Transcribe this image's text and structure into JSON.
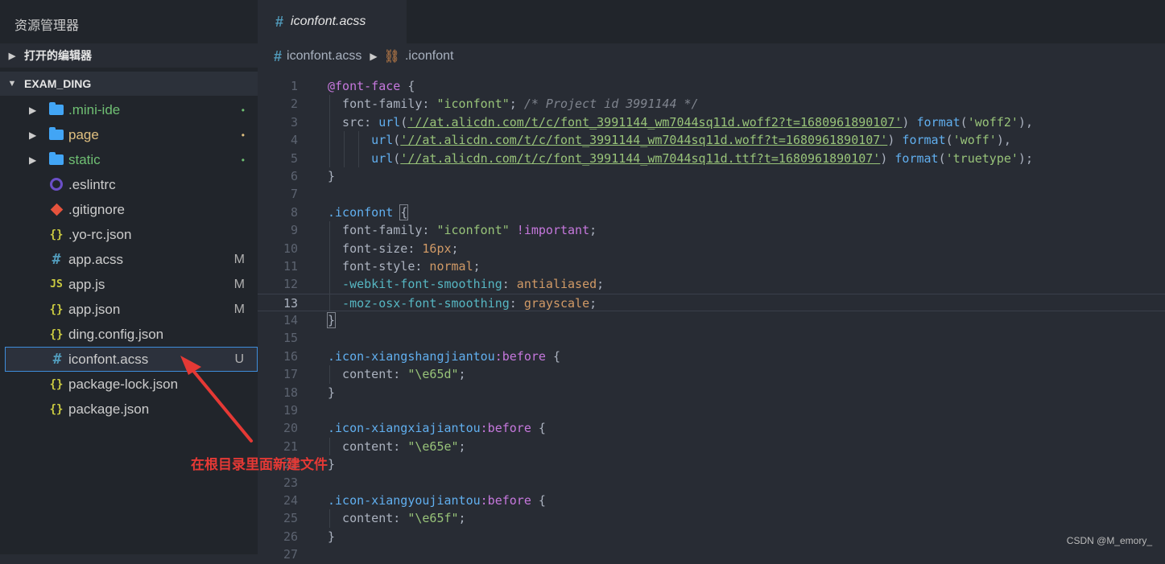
{
  "sidebar": {
    "title": "资源管理器",
    "open_editors": "打开的编辑器",
    "project": "EXAM_DING",
    "files": [
      {
        "name": ".mini-ide",
        "type": "folder",
        "badge": "•",
        "color": "#6fbf73"
      },
      {
        "name": "page",
        "type": "folder",
        "badge": "•",
        "color": "#e0c080"
      },
      {
        "name": "static",
        "type": "folder",
        "badge": "•",
        "color": "#6fbf73"
      },
      {
        "name": ".eslintrc",
        "type": "eslint",
        "badge": "",
        "color": "#cccccc"
      },
      {
        "name": ".gitignore",
        "type": "git",
        "badge": "",
        "color": "#cccccc"
      },
      {
        "name": ".yo-rc.json",
        "type": "json",
        "badge": "",
        "color": "#cccccc"
      },
      {
        "name": "app.acss",
        "type": "css",
        "badge": "M",
        "color": "#cccccc"
      },
      {
        "name": "app.js",
        "type": "js",
        "badge": "M",
        "color": "#cccccc"
      },
      {
        "name": "app.json",
        "type": "json",
        "badge": "M",
        "color": "#cccccc"
      },
      {
        "name": "ding.config.json",
        "type": "json",
        "badge": "",
        "color": "#cccccc"
      },
      {
        "name": "iconfont.acss",
        "type": "css",
        "badge": "U",
        "color": "#cccccc",
        "selected": true
      },
      {
        "name": "package-lock.json",
        "type": "json",
        "badge": "",
        "color": "#cccccc"
      },
      {
        "name": "package.json",
        "type": "json",
        "badge": "",
        "color": "#cccccc"
      }
    ]
  },
  "tab": {
    "label": "iconfont.acss"
  },
  "breadcrumb": {
    "file": "iconfont.acss",
    "symbol": ".iconfont"
  },
  "editor": {
    "current_line": 13,
    "lines": [
      {
        "n": "1",
        "tokens": [
          [
            "at",
            "@font-face"
          ],
          [
            "brace",
            " {"
          ]
        ]
      },
      {
        "n": "2",
        "indent": 1,
        "tokens": [
          [
            "prop",
            "font-family"
          ],
          [
            "brace",
            ": "
          ],
          [
            "str",
            "\"iconfont\""
          ],
          [
            "brace",
            "; "
          ],
          [
            "com",
            "/* Project id 3991144 */"
          ]
        ]
      },
      {
        "n": "3",
        "indent": 1,
        "tokens": [
          [
            "prop",
            "src"
          ],
          [
            "brace",
            ": "
          ],
          [
            "fn",
            "url"
          ],
          [
            "brace",
            "("
          ],
          [
            "url",
            "'//at.alicdn.com/t/c/font_3991144_wm7044sq11d.woff2?t=1680961890107'"
          ],
          [
            "brace",
            ") "
          ],
          [
            "fn",
            "format"
          ],
          [
            "brace",
            "("
          ],
          [
            "str",
            "'woff2'"
          ],
          [
            "brace",
            "),"
          ]
        ]
      },
      {
        "n": "4",
        "indent": 3,
        "tokens": [
          [
            "fn",
            "url"
          ],
          [
            "brace",
            "("
          ],
          [
            "url",
            "'//at.alicdn.com/t/c/font_3991144_wm7044sq11d.woff?t=1680961890107'"
          ],
          [
            "brace",
            ") "
          ],
          [
            "fn",
            "format"
          ],
          [
            "brace",
            "("
          ],
          [
            "str",
            "'woff'"
          ],
          [
            "brace",
            "),"
          ]
        ]
      },
      {
        "n": "5",
        "indent": 3,
        "tokens": [
          [
            "fn",
            "url"
          ],
          [
            "brace",
            "("
          ],
          [
            "url",
            "'//at.alicdn.com/t/c/font_3991144_wm7044sq11d.ttf?t=1680961890107'"
          ],
          [
            "brace",
            ") "
          ],
          [
            "fn",
            "format"
          ],
          [
            "brace",
            "("
          ],
          [
            "str",
            "'truetype'"
          ],
          [
            "brace",
            ");"
          ]
        ]
      },
      {
        "n": "6",
        "tokens": [
          [
            "brace",
            "}"
          ]
        ]
      },
      {
        "n": "7",
        "tokens": []
      },
      {
        "n": "8",
        "tokens": [
          [
            "cls",
            ".iconfont"
          ],
          [
            "brace",
            " "
          ],
          [
            "bracehl",
            "{"
          ]
        ]
      },
      {
        "n": "9",
        "indent": 1,
        "tokens": [
          [
            "prop",
            "font-family"
          ],
          [
            "brace",
            ": "
          ],
          [
            "str",
            "\"iconfont\""
          ],
          [
            "brace",
            " "
          ],
          [
            "imp",
            "!important"
          ],
          [
            "brace",
            ";"
          ]
        ]
      },
      {
        "n": "10",
        "indent": 1,
        "tokens": [
          [
            "prop",
            "font-size"
          ],
          [
            "brace",
            ": "
          ],
          [
            "num",
            "16px"
          ],
          [
            "brace",
            ";"
          ]
        ]
      },
      {
        "n": "11",
        "indent": 1,
        "tokens": [
          [
            "prop",
            "font-style"
          ],
          [
            "brace",
            ": "
          ],
          [
            "kw",
            "normal"
          ],
          [
            "brace",
            ";"
          ]
        ]
      },
      {
        "n": "12",
        "indent": 1,
        "tokens": [
          [
            "vendor",
            "-webkit-font-smoothing"
          ],
          [
            "brace",
            ": "
          ],
          [
            "kw",
            "antialiased"
          ],
          [
            "brace",
            ";"
          ]
        ]
      },
      {
        "n": "13",
        "indent": 1,
        "tokens": [
          [
            "vendor",
            "-moz-osx-font-smoothing"
          ],
          [
            "brace",
            ": "
          ],
          [
            "kw",
            "grayscale"
          ],
          [
            "brace",
            ";"
          ]
        ]
      },
      {
        "n": "14",
        "tokens": [
          [
            "bracehl",
            "}"
          ]
        ]
      },
      {
        "n": "15",
        "tokens": []
      },
      {
        "n": "16",
        "tokens": [
          [
            "cls",
            ".icon-xiangshangjiantou"
          ],
          [
            "pseudo",
            ":before"
          ],
          [
            "brace",
            " {"
          ]
        ]
      },
      {
        "n": "17",
        "indent": 1,
        "tokens": [
          [
            "prop",
            "content"
          ],
          [
            "brace",
            ": "
          ],
          [
            "str",
            "\"\\e65d\""
          ],
          [
            "brace",
            ";"
          ]
        ]
      },
      {
        "n": "18",
        "tokens": [
          [
            "brace",
            "}"
          ]
        ]
      },
      {
        "n": "19",
        "tokens": []
      },
      {
        "n": "20",
        "tokens": [
          [
            "cls",
            ".icon-xiangxiajiantou"
          ],
          [
            "pseudo",
            ":before"
          ],
          [
            "brace",
            " {"
          ]
        ]
      },
      {
        "n": "21",
        "indent": 1,
        "tokens": [
          [
            "prop",
            "content"
          ],
          [
            "brace",
            ": "
          ],
          [
            "str",
            "\"\\e65e\""
          ],
          [
            "brace",
            ";"
          ]
        ]
      },
      {
        "n": "22",
        "tokens": [
          [
            "brace",
            "}"
          ]
        ]
      },
      {
        "n": "23",
        "tokens": []
      },
      {
        "n": "24",
        "tokens": [
          [
            "cls",
            ".icon-xiangyoujiantou"
          ],
          [
            "pseudo",
            ":before"
          ],
          [
            "brace",
            " {"
          ]
        ]
      },
      {
        "n": "25",
        "indent": 1,
        "tokens": [
          [
            "prop",
            "content"
          ],
          [
            "brace",
            ": "
          ],
          [
            "str",
            "\"\\e65f\""
          ],
          [
            "brace",
            ";"
          ]
        ]
      },
      {
        "n": "26",
        "tokens": [
          [
            "brace",
            "}"
          ]
        ]
      },
      {
        "n": "27",
        "tokens": []
      }
    ]
  },
  "annotation": {
    "text": "在根目录里面新建文件",
    "color": "#e53935"
  },
  "watermark": "CSDN @M_emory_"
}
